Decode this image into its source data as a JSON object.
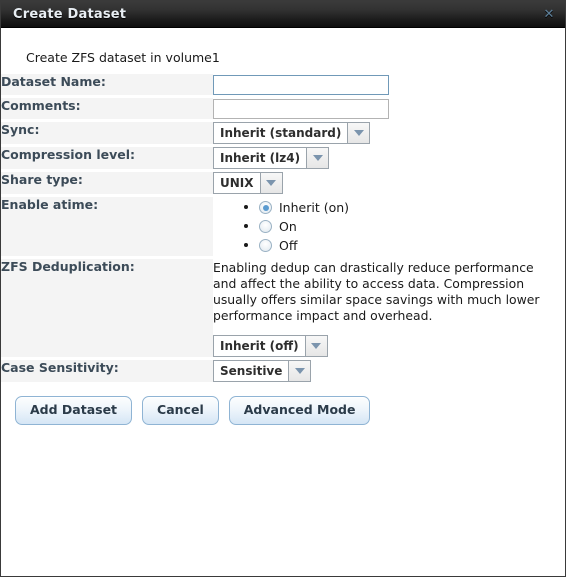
{
  "window": {
    "title": "Create Dataset",
    "close_icon": "close-icon",
    "close_glyph": "✕"
  },
  "intro": "Create ZFS dataset in volume1",
  "colors": {
    "titlebar": "#1d1d1d",
    "title_text": "#e8eef3",
    "close_icon": "#5d7f99",
    "label_bg": "#f4f4f4",
    "label_text": "#3c4b58",
    "focus_border": "#7099b8",
    "accent_blue": "#5b9bd0",
    "button_border": "#8fb4d4"
  },
  "rows": [
    {
      "label": "Dataset Name:",
      "type": "text",
      "name": "dataset-name",
      "value": "",
      "placeholder": "",
      "focused": true
    },
    {
      "label": "Comments:",
      "type": "text",
      "name": "comments",
      "value": "",
      "placeholder": "",
      "focused": false
    },
    {
      "label": "Sync:",
      "type": "select",
      "name": "sync",
      "value": "Inherit (standard)"
    },
    {
      "label": "Compression level:",
      "type": "select",
      "name": "compression-level",
      "value": "Inherit (lz4)"
    },
    {
      "label": "Share type:",
      "type": "select",
      "name": "share-type",
      "value": "UNIX"
    },
    {
      "label": "Enable atime:",
      "type": "radio",
      "name": "enable-atime",
      "options": [
        {
          "label": "Inherit (on)",
          "checked": true
        },
        {
          "label": "On",
          "checked": false
        },
        {
          "label": "Off",
          "checked": false
        }
      ]
    },
    {
      "label": "ZFS Deduplication:",
      "type": "note-select",
      "name": "zfs-deduplication",
      "note": "Enabling dedup can drastically reduce performance and affect the ability to access data. Compression usually offers similar space savings with much lower performance impact and overhead.",
      "value": "Inherit (off)"
    },
    {
      "label": "Case Sensitivity:",
      "type": "select",
      "name": "case-sensitivity",
      "value": "Sensitive"
    }
  ],
  "footer": {
    "buttons": [
      {
        "label": "Add Dataset",
        "name": "add-dataset-button"
      },
      {
        "label": "Cancel",
        "name": "cancel-button"
      },
      {
        "label": "Advanced Mode",
        "name": "advanced-mode-button"
      }
    ]
  }
}
